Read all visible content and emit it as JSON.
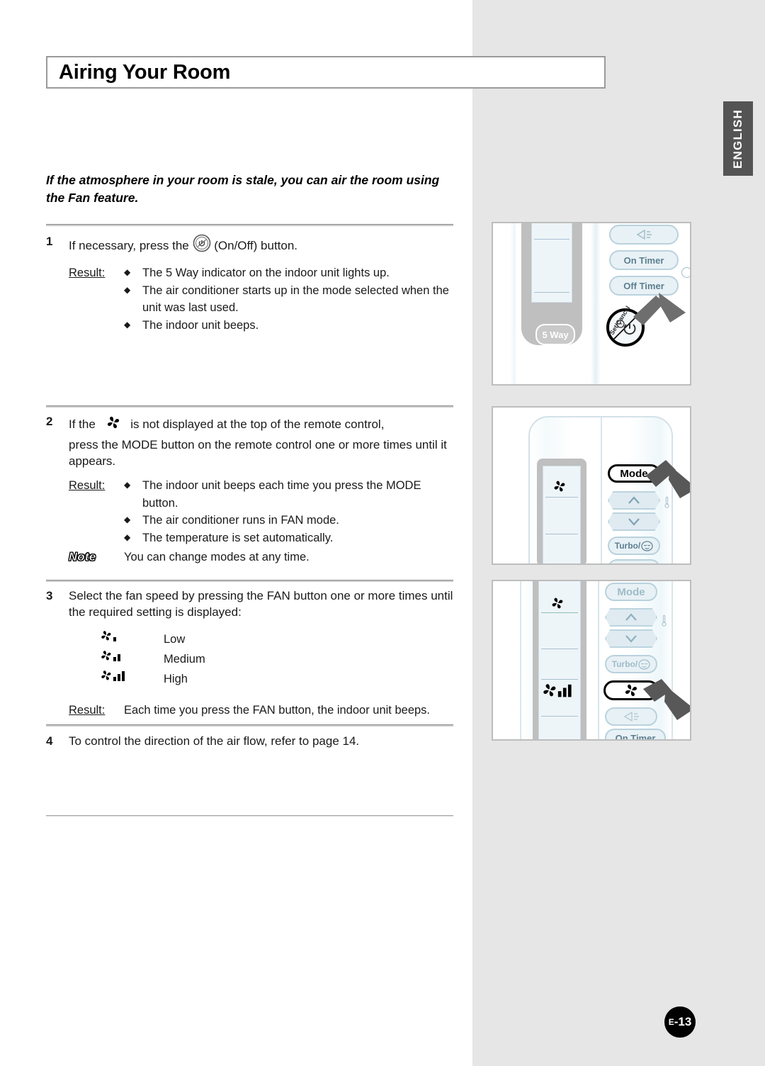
{
  "page": {
    "title": "Airing Your Room",
    "language_tab": "ENGLISH",
    "page_number": "E-13",
    "page_number_prefix": "E",
    "page_number_value": "-13"
  },
  "intro": "If the atmosphere in your room is stale, you can air the room using the Fan feature.",
  "steps": [
    {
      "number": "1",
      "text_before_icon": "If necessary, press the",
      "icon": "onoff-power-icon",
      "text_after_icon": "(On/Off) button.",
      "result_label": "Result:",
      "bullets": [
        "The 5 Way indicator on the indoor unit lights up.",
        "The air conditioner starts up in the mode selected when the unit was last used.",
        "The indoor unit beeps."
      ]
    },
    {
      "number": "2",
      "text_before_icon": "If the",
      "icon": "fan-propeller-icon",
      "text_after_icon": "is not displayed at the top of the remote control,",
      "line2": "press the MODE button on the remote control one or more times until it appears.",
      "result_label": "Result:",
      "bullets": [
        "The indoor unit beeps each time you press the MODE button.",
        "The air conditioner runs in FAN mode.",
        "The temperature is set automatically."
      ],
      "note_label": "Note",
      "note_text": "You can change modes at any time."
    },
    {
      "number": "3",
      "text": "Select the fan speed by pressing the FAN button one or more times until the required setting is displayed:",
      "speeds": [
        {
          "icon": "fan-speed-low-icon",
          "bars": 1,
          "label": "Low"
        },
        {
          "icon": "fan-speed-medium-icon",
          "bars": 2,
          "label": "Medium"
        },
        {
          "icon": "fan-speed-high-icon",
          "bars": 3,
          "label": "High"
        }
      ],
      "result_label": "Result:",
      "result_text": "Each time you press the FAN button, the indoor unit beeps."
    },
    {
      "number": "4",
      "text": "To control the direction of the air flow, refer to page 14."
    }
  ],
  "panels": [
    {
      "name": "remote-top-power",
      "buttons": [
        {
          "label": "",
          "icon": "airflow-icon"
        },
        {
          "label": "On Timer"
        },
        {
          "label": "Off Timer"
        }
      ],
      "badge": "5 Way",
      "power_label": "Set/Cancel",
      "highlighted": "power-button"
    },
    {
      "name": "remote-mode",
      "buttons": [
        {
          "label": "Mode"
        },
        {
          "label": "",
          "icon": "chevron-up-icon"
        },
        {
          "label": "",
          "icon": "chevron-down-icon"
        },
        {
          "label": "Turbo/",
          "icon": "sleep-face-icon"
        }
      ],
      "display_icon": "fan-propeller-icon",
      "highlighted": "Mode"
    },
    {
      "name": "remote-fan",
      "buttons": [
        {
          "label": "Mode"
        },
        {
          "label": "",
          "icon": "chevron-up-icon"
        },
        {
          "label": "",
          "icon": "chevron-down-icon"
        },
        {
          "label": "Turbo/",
          "icon": "sleep-face-icon"
        },
        {
          "label": "",
          "icon": "fan-propeller-icon"
        },
        {
          "label": "",
          "icon": "airflow-icon"
        },
        {
          "label": "On Timer"
        }
      ],
      "display_icon": "fan-propeller-icon",
      "display_speed_icon": "fan-speed-high-icon",
      "highlighted": "fan-button"
    }
  ],
  "colors": {
    "page_right_bg": "#e6e6e6",
    "lang_tab_bg": "#545454",
    "rule": "#8d8d8d",
    "button_fill": "#e8f1f5",
    "button_border": "#b9d2dd",
    "badge_bg": "#c9c9c9",
    "arrow": "#6e6e6e"
  }
}
